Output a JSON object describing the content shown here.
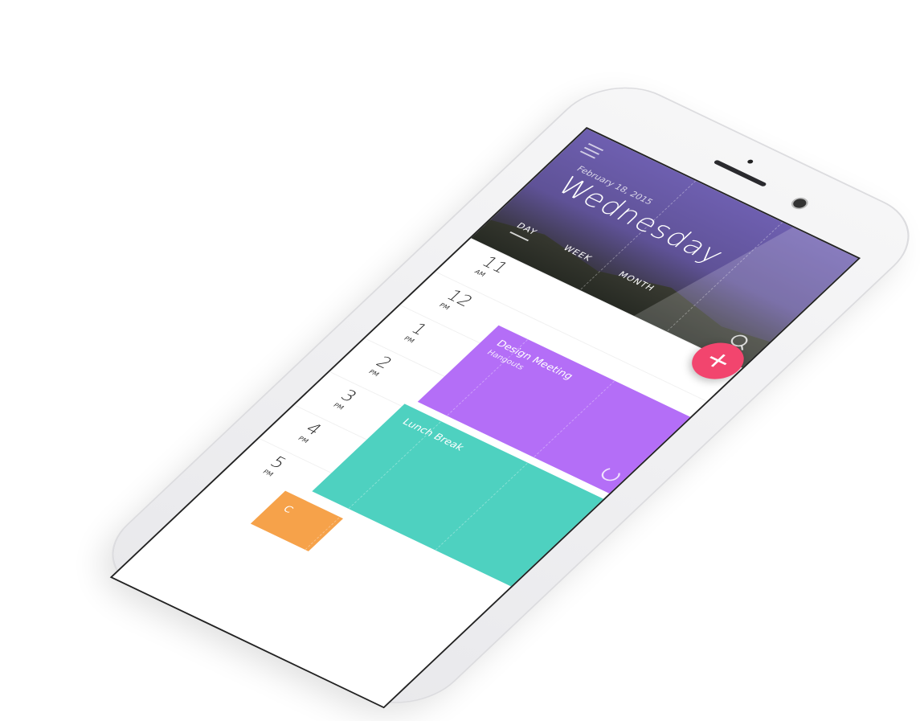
{
  "header": {
    "day": "Wednesday",
    "date": "February 18, 2015"
  },
  "tabs": [
    {
      "label": "DAY",
      "active": true
    },
    {
      "label": "WEEK",
      "active": false
    },
    {
      "label": "MONTH",
      "active": false
    }
  ],
  "hours": [
    {
      "hour": "11",
      "period": "AM"
    },
    {
      "hour": "12",
      "period": "PM"
    },
    {
      "hour": "1",
      "period": "PM"
    },
    {
      "hour": "2",
      "period": "PM"
    },
    {
      "hour": "3",
      "period": "PM"
    },
    {
      "hour": "4",
      "period": "PM"
    },
    {
      "hour": "5",
      "period": "PM"
    }
  ],
  "events": [
    {
      "title": "Design Meeting",
      "subtitle": "Hangouts",
      "color": "#b46ef7"
    },
    {
      "title": "Lunch Break",
      "color": "#4ed1c0"
    },
    {
      "title": "C",
      "color": "#f6a24a"
    }
  ],
  "fab": {
    "label": "+"
  },
  "colors": {
    "accent": "#f2456e"
  }
}
